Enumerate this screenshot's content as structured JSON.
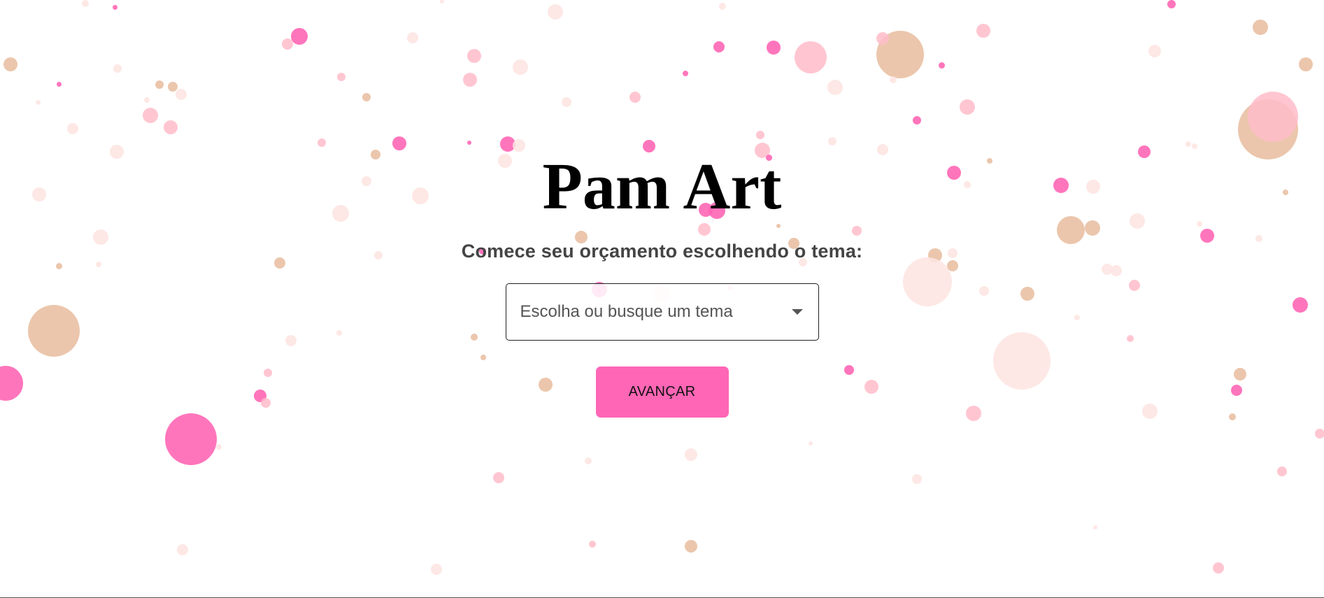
{
  "header": {
    "title": "Pam Art"
  },
  "main": {
    "subtitle": "Comece seu orçamento escolhendo o tema:",
    "theme_select": {
      "placeholder": "Escolha ou busque um tema"
    },
    "next_button": {
      "label": "AVANÇAR"
    }
  },
  "colors": {
    "background": "#ffffff",
    "accent_pink": "#ff66b5",
    "soft_pink": "#ffbcc9",
    "pale_pink": "#fde4e0",
    "tan": "#e8bc9e",
    "title": "#000000",
    "subtitle": "#444444"
  },
  "background": {
    "decoration": "confetti-dots"
  }
}
